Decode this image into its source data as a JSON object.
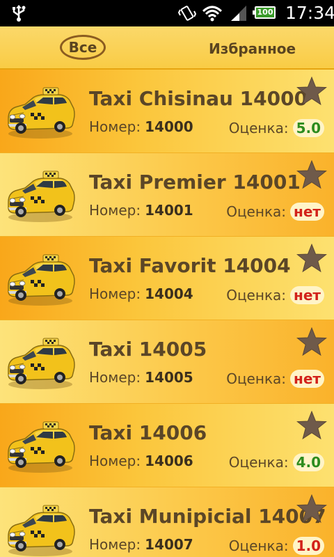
{
  "status_bar": {
    "time": "17:34",
    "battery": "100",
    "icons": [
      "usb-icon",
      "vibrate-icon",
      "wifi-icon",
      "signal-icon",
      "battery-icon"
    ]
  },
  "tabs": {
    "all_label": "Все",
    "favorites_label": "Избранное",
    "active": "all"
  },
  "labels": {
    "number": "Номер:",
    "rating": "Оценка:"
  },
  "colors": {
    "rating_good": "#2d8c1e",
    "rating_none": "#d2221a",
    "text": "#5b4627"
  },
  "taxis": [
    {
      "name": "Taxi Chisinau 14000",
      "number": "14000",
      "rating": "5.0",
      "rating_state": "good"
    },
    {
      "name": "Taxi Premier 14001",
      "number": "14001",
      "rating": "нет",
      "rating_state": "none"
    },
    {
      "name": "Taxi Favorit 14004",
      "number": "14004",
      "rating": "нет",
      "rating_state": "none"
    },
    {
      "name": "Taxi 14005",
      "number": "14005",
      "rating": "нет",
      "rating_state": "none"
    },
    {
      "name": "Taxi 14006",
      "number": "14006",
      "rating": "4.0",
      "rating_state": "good"
    },
    {
      "name": "Taxi Munipicial 14007",
      "number": "14007",
      "rating": "1.0",
      "rating_state": "none"
    }
  ]
}
